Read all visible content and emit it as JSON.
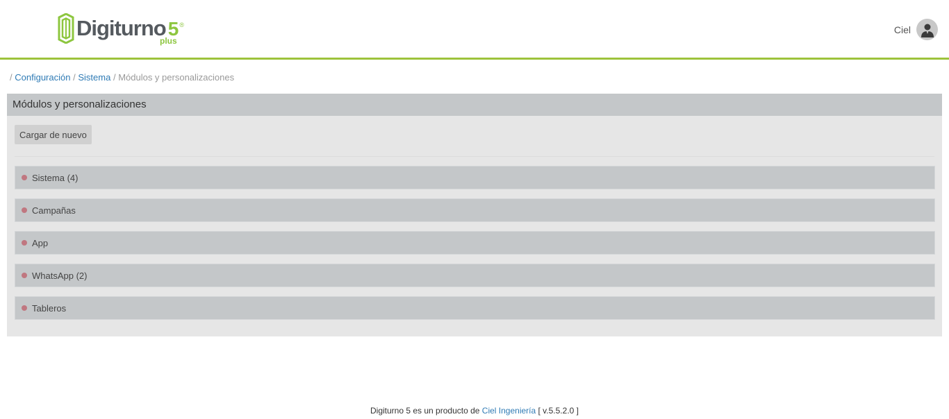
{
  "brand": {
    "word": "Digiturno",
    "number": "5",
    "registered": "®",
    "edition": "plus",
    "color_green": "#8dc63f",
    "color_gray": "#555a5f"
  },
  "user": {
    "name": "Ciel",
    "avatar_icon": "user-avatar-icon"
  },
  "breadcrumb": {
    "root_sep": "/",
    "items": [
      {
        "label": "Configuración",
        "link": true
      },
      {
        "label": "Sistema",
        "link": true
      },
      {
        "label": "Módulos y personalizaciones",
        "link": false
      }
    ],
    "separator": "/"
  },
  "panel": {
    "title": "Módulos y personalizaciones",
    "reload_label": "Cargar de nuevo",
    "modules": [
      {
        "label": "Sistema (4)"
      },
      {
        "label": "Campañas"
      },
      {
        "label": "App"
      },
      {
        "label": "WhatsApp (2)"
      },
      {
        "label": "Tableros"
      }
    ],
    "status_dot_color": "#c07780"
  },
  "footer": {
    "prefix": "Digiturno 5 es un producto de",
    "company": "Ciel Ingeniería",
    "version": "[ v.5.5.2.0 ]"
  },
  "colors": {
    "accent": "#9dc33b",
    "link": "#2f7bb5",
    "panel_header": "#c4c7c9",
    "panel_bg": "#e6e6e6"
  }
}
